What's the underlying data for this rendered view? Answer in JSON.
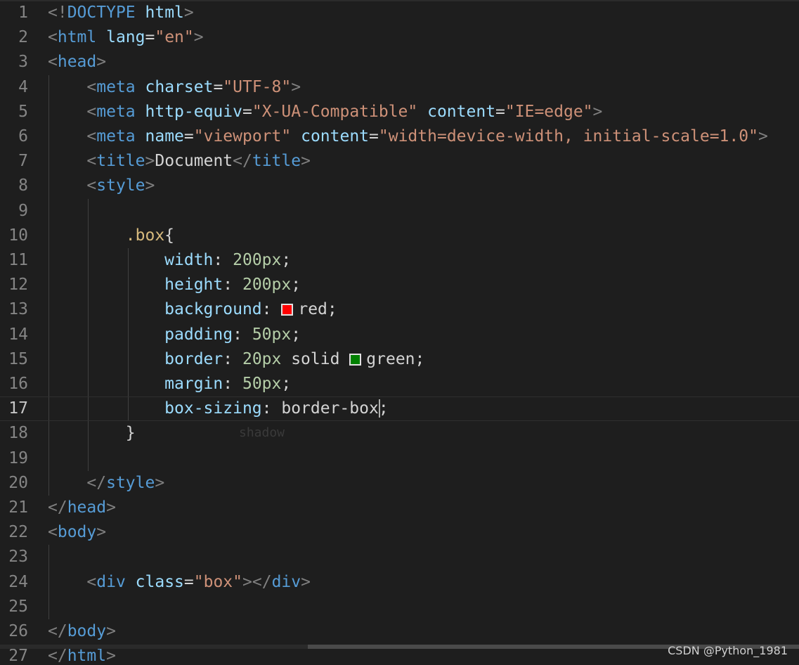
{
  "editor": {
    "language": "html",
    "active_line": "17",
    "colors": {
      "background": "#1e1e1e",
      "tag_bracket": "#808080",
      "tag_name": "#569cd6",
      "attribute": "#9cdcfe",
      "string": "#ce9178",
      "selector": "#d7ba7d",
      "number": "#b5cea8",
      "text": "#d4d4d4"
    },
    "lines": [
      {
        "n": "1",
        "t": [
          [
            "t",
            "<!"
          ],
          [
            "n",
            "DOCTYPE"
          ],
          [
            "w",
            " "
          ],
          [
            "a",
            "html"
          ],
          [
            "t",
            ">"
          ]
        ]
      },
      {
        "n": "2",
        "t": [
          [
            "t",
            "<"
          ],
          [
            "n",
            "html"
          ],
          [
            "w",
            " "
          ],
          [
            "a",
            "lang"
          ],
          [
            "w",
            "="
          ],
          [
            "s",
            "\"en\""
          ],
          [
            "t",
            ">"
          ]
        ]
      },
      {
        "n": "3",
        "t": [
          [
            "t",
            "<"
          ],
          [
            "n",
            "head"
          ],
          [
            "t",
            ">"
          ]
        ]
      },
      {
        "n": "4",
        "t": [
          [
            "w",
            "    "
          ],
          [
            "t",
            "<"
          ],
          [
            "n",
            "meta"
          ],
          [
            "w",
            " "
          ],
          [
            "a",
            "charset"
          ],
          [
            "w",
            "="
          ],
          [
            "s",
            "\"UTF-8\""
          ],
          [
            "t",
            ">"
          ]
        ]
      },
      {
        "n": "5",
        "t": [
          [
            "w",
            "    "
          ],
          [
            "t",
            "<"
          ],
          [
            "n",
            "meta"
          ],
          [
            "w",
            " "
          ],
          [
            "a",
            "http-equiv"
          ],
          [
            "w",
            "="
          ],
          [
            "s",
            "\"X-UA-Compatible\""
          ],
          [
            "w",
            " "
          ],
          [
            "a",
            "content"
          ],
          [
            "w",
            "="
          ],
          [
            "s",
            "\"IE=edge\""
          ],
          [
            "t",
            ">"
          ]
        ]
      },
      {
        "n": "6",
        "t": [
          [
            "w",
            "    "
          ],
          [
            "t",
            "<"
          ],
          [
            "n",
            "meta"
          ],
          [
            "w",
            " "
          ],
          [
            "a",
            "name"
          ],
          [
            "w",
            "="
          ],
          [
            "s",
            "\"viewport\""
          ],
          [
            "w",
            " "
          ],
          [
            "a",
            "content"
          ],
          [
            "w",
            "="
          ],
          [
            "s",
            "\"width=device-width, initial-scale=1.0\""
          ],
          [
            "t",
            ">"
          ]
        ]
      },
      {
        "n": "7",
        "t": [
          [
            "w",
            "    "
          ],
          [
            "t",
            "<"
          ],
          [
            "n",
            "title"
          ],
          [
            "t",
            ">"
          ],
          [
            "w",
            "Document"
          ],
          [
            "t",
            "</"
          ],
          [
            "n",
            "title"
          ],
          [
            "t",
            ">"
          ]
        ]
      },
      {
        "n": "8",
        "t": [
          [
            "w",
            "    "
          ],
          [
            "t",
            "<"
          ],
          [
            "n",
            "style"
          ],
          [
            "t",
            ">"
          ]
        ]
      },
      {
        "n": "9",
        "t": []
      },
      {
        "n": "10",
        "t": [
          [
            "w",
            "        "
          ],
          [
            "sel",
            ".box"
          ],
          [
            "w",
            "{"
          ]
        ]
      },
      {
        "n": "11",
        "t": [
          [
            "w",
            "            "
          ],
          [
            "a",
            "width"
          ],
          [
            "w",
            ": "
          ],
          [
            "num",
            "200px"
          ],
          [
            "w",
            ";"
          ]
        ]
      },
      {
        "n": "12",
        "t": [
          [
            "w",
            "            "
          ],
          [
            "a",
            "height"
          ],
          [
            "w",
            ": "
          ],
          [
            "num",
            "200px"
          ],
          [
            "w",
            ";"
          ]
        ]
      },
      {
        "n": "13",
        "t": [
          [
            "w",
            "            "
          ],
          [
            "a",
            "background"
          ],
          [
            "w",
            ": "
          ],
          [
            "swatch",
            "#ff0000"
          ],
          [
            "w",
            "red;"
          ]
        ]
      },
      {
        "n": "14",
        "t": [
          [
            "w",
            "            "
          ],
          [
            "a",
            "padding"
          ],
          [
            "w",
            ": "
          ],
          [
            "num",
            "50px"
          ],
          [
            "w",
            ";"
          ]
        ]
      },
      {
        "n": "15",
        "t": [
          [
            "w",
            "            "
          ],
          [
            "a",
            "border"
          ],
          [
            "w",
            ": "
          ],
          [
            "num",
            "20px"
          ],
          [
            "w",
            " solid "
          ],
          [
            "swatch",
            "#008000"
          ],
          [
            "w",
            "green;"
          ]
        ]
      },
      {
        "n": "16",
        "t": [
          [
            "w",
            "            "
          ],
          [
            "a",
            "margin"
          ],
          [
            "w",
            ": "
          ],
          [
            "num",
            "50px"
          ],
          [
            "w",
            ";"
          ]
        ]
      },
      {
        "n": "17",
        "t": [
          [
            "w",
            "            "
          ],
          [
            "a",
            "box-sizing"
          ],
          [
            "w",
            ": border-box"
          ],
          [
            "cursor",
            ""
          ],
          [
            "w",
            ";"
          ]
        ]
      },
      {
        "n": "18",
        "t": [
          [
            "w",
            "        "
          ],
          [
            "w",
            "}"
          ]
        ]
      },
      {
        "n": "19",
        "t": []
      },
      {
        "n": "20",
        "t": [
          [
            "w",
            "    "
          ],
          [
            "t",
            "</"
          ],
          [
            "n",
            "style"
          ],
          [
            "t",
            ">"
          ]
        ]
      },
      {
        "n": "21",
        "t": [
          [
            "t",
            "</"
          ],
          [
            "n",
            "head"
          ],
          [
            "t",
            ">"
          ]
        ]
      },
      {
        "n": "22",
        "t": [
          [
            "t",
            "<"
          ],
          [
            "n",
            "body"
          ],
          [
            "t",
            ">"
          ]
        ]
      },
      {
        "n": "23",
        "t": []
      },
      {
        "n": "24",
        "t": [
          [
            "w",
            "    "
          ],
          [
            "t",
            "<"
          ],
          [
            "n",
            "div"
          ],
          [
            "w",
            " "
          ],
          [
            "a",
            "class"
          ],
          [
            "w",
            "="
          ],
          [
            "s",
            "\"box\""
          ],
          [
            "t",
            "></"
          ],
          [
            "n",
            "div"
          ],
          [
            "t",
            ">"
          ]
        ]
      },
      {
        "n": "25",
        "t": []
      },
      {
        "n": "26",
        "t": [
          [
            "t",
            "</"
          ],
          [
            "n",
            "body"
          ],
          [
            "t",
            ">"
          ]
        ]
      },
      {
        "n": "27",
        "t": [
          [
            "t",
            "</"
          ],
          [
            "n",
            "html"
          ],
          [
            "t",
            ">"
          ]
        ]
      }
    ],
    "ghost_text": "shadow"
  },
  "watermark": "CSDN @Python_1981"
}
